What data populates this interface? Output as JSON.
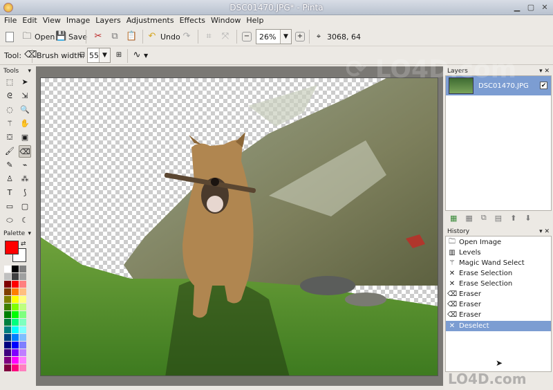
{
  "window": {
    "title": "DSC01470.JPG* - Pinta"
  },
  "menu": [
    "File",
    "Edit",
    "View",
    "Image",
    "Layers",
    "Adjustments",
    "Effects",
    "Window",
    "Help"
  ],
  "toolbar": {
    "open_label": "Open",
    "save_label": "Save",
    "undo_label": "Undo",
    "zoom_value": "26%",
    "cursor_position": "3068, 64"
  },
  "toolbar2": {
    "tool_label": "Tool:",
    "brush_width_label": "Brush width:",
    "brush_width_value": "55"
  },
  "panels": {
    "tools_title": "Tools",
    "palette_title": "Palette",
    "layers_title": "Layers",
    "history_title": "History"
  },
  "layers": [
    {
      "name": "DSC01470.JPG",
      "visible": true
    }
  ],
  "history": [
    {
      "label": "Open Image",
      "icon": "open-image-icon"
    },
    {
      "label": "Levels",
      "icon": "levels-icon"
    },
    {
      "label": "Magic Wand Select",
      "icon": "magic-wand-icon"
    },
    {
      "label": "Erase Selection",
      "icon": "erase-selection-icon"
    },
    {
      "label": "Erase Selection",
      "icon": "erase-selection-icon"
    },
    {
      "label": "Eraser",
      "icon": "eraser-icon"
    },
    {
      "label": "Eraser",
      "icon": "eraser-icon"
    },
    {
      "label": "Eraser",
      "icon": "eraser-icon"
    },
    {
      "label": "Deselect",
      "icon": "deselect-icon",
      "selected": true
    }
  ],
  "colors": {
    "primary": "#ff0000",
    "secondary": "#ffffff",
    "selection": "#7c9dd2"
  },
  "watermark": "LO4D.com"
}
